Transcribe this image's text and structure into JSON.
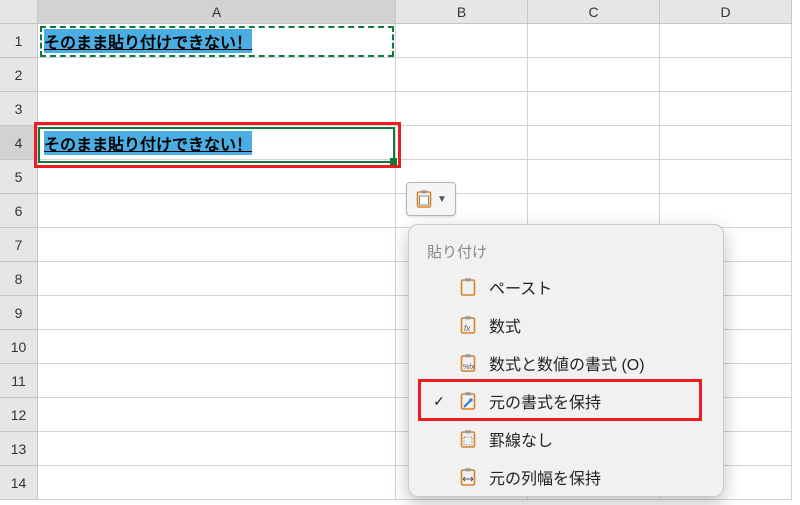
{
  "columns": {
    "A": "A",
    "B": "B",
    "C": "C",
    "D": "D"
  },
  "rows": {
    "r1": "1",
    "r2": "2",
    "r3": "3",
    "r4": "4",
    "r5": "5",
    "r6": "6",
    "r7": "7",
    "r8": "8",
    "r9": "9",
    "r10": "10",
    "r11": "11",
    "r12": "12",
    "r13": "13",
    "r14": "14"
  },
  "cells": {
    "A1": "そのまま貼り付けできない！",
    "A4": "そのまま貼り付けできない！"
  },
  "pasteMenu": {
    "header": "貼り付け",
    "items": {
      "paste": "ペースト",
      "formulas": "数式",
      "formulas_number_fmt": "数式と数値の書式 (O)",
      "keep_source_fmt": "元の書式を保持",
      "no_borders": "罫線なし",
      "keep_col_width": "元の列幅を保持"
    }
  }
}
